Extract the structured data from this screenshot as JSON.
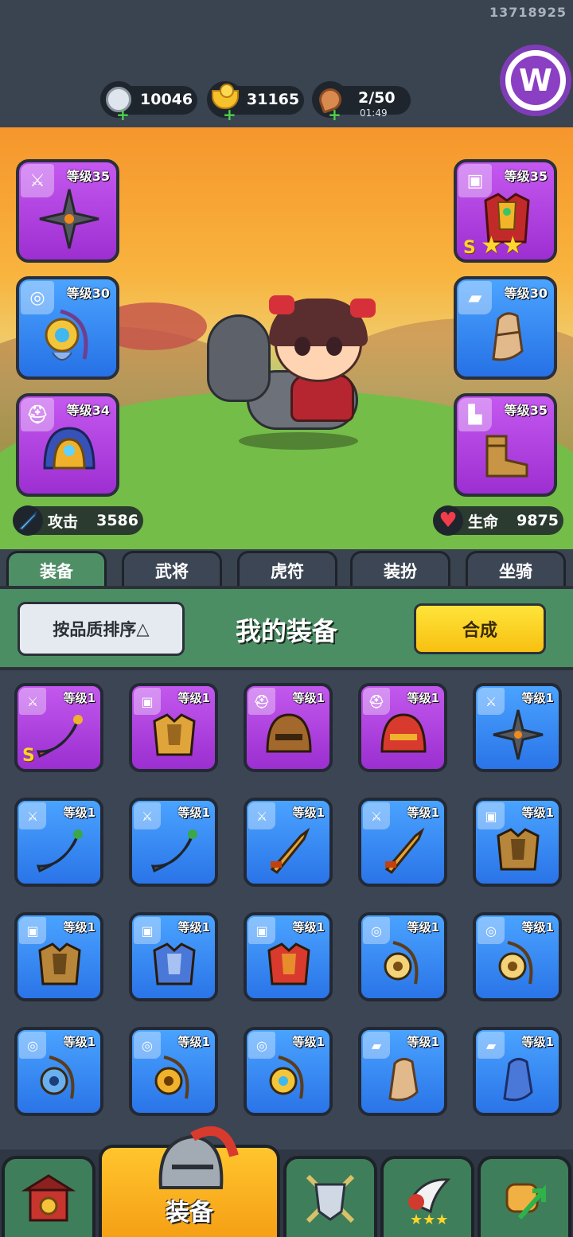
{
  "user_id": "13718925",
  "resources": {
    "silver": {
      "value": "10046",
      "icon": "silver-coin-icon"
    },
    "gold": {
      "value": "31165",
      "icon": "gold-ingot-icon"
    },
    "stamina": {
      "value": "2/50",
      "timer": "01:49",
      "icon": "meat-icon"
    }
  },
  "equipped": {
    "weapon": {
      "level": "等级35",
      "icon": "shuriken-icon",
      "type": "sword-badge",
      "rarity": "purple"
    },
    "amulet": {
      "level": "等级30",
      "icon": "amulet-icon",
      "type": "medal-badge",
      "rarity": "blue"
    },
    "helmet": {
      "level": "等级34",
      "icon": "helmet-icon",
      "type": "helmet-badge",
      "rarity": "purple"
    },
    "armor": {
      "level": "等级35",
      "icon": "armor-icon",
      "type": "armor-badge",
      "rarity": "purple",
      "rank": "S",
      "stars": 2
    },
    "gauntlet": {
      "level": "等级30",
      "icon": "gauntlet-icon",
      "type": "gauntlet-badge",
      "rarity": "blue"
    },
    "boots": {
      "level": "等级35",
      "icon": "boots-icon",
      "type": "boot-badge",
      "rarity": "purple"
    }
  },
  "stats": {
    "attack": {
      "label": "攻击",
      "value": "3586"
    },
    "hp": {
      "label": "生命",
      "value": "9875"
    }
  },
  "tabs": [
    "装备",
    "武将",
    "虎符",
    "装扮",
    "坐骑"
  ],
  "panel": {
    "sort_label": "按品质排序",
    "sort_arrow": "△",
    "title": "我的装备",
    "merge_label": "合成"
  },
  "inventory": [
    {
      "level": "等级1",
      "rarity": "purple",
      "badge": "sword",
      "icon": "scimitar-icon",
      "rank": "S"
    },
    {
      "level": "等级1",
      "rarity": "purple",
      "badge": "armor",
      "icon": "gold-armor-icon"
    },
    {
      "level": "等级1",
      "rarity": "purple",
      "badge": "helmet",
      "icon": "bronze-helmet-icon"
    },
    {
      "level": "等级1",
      "rarity": "purple",
      "badge": "helmet",
      "icon": "red-helmet-icon"
    },
    {
      "level": "等级1",
      "rarity": "blue",
      "badge": "sword",
      "icon": "shuriken-icon"
    },
    {
      "level": "等级1",
      "rarity": "blue",
      "badge": "sword",
      "icon": "curved-blade-icon"
    },
    {
      "level": "等级1",
      "rarity": "blue",
      "badge": "sword",
      "icon": "curved-blade-icon"
    },
    {
      "level": "等级1",
      "rarity": "blue",
      "badge": "sword",
      "icon": "golden-dagger-icon"
    },
    {
      "level": "等级1",
      "rarity": "blue",
      "badge": "sword",
      "icon": "golden-dagger-icon"
    },
    {
      "level": "等级1",
      "rarity": "blue",
      "badge": "armor",
      "icon": "bronze-armor-icon"
    },
    {
      "level": "等级1",
      "rarity": "blue",
      "badge": "armor",
      "icon": "bronze-armor-icon"
    },
    {
      "level": "等级1",
      "rarity": "blue",
      "badge": "armor",
      "icon": "blue-robe-icon"
    },
    {
      "level": "等级1",
      "rarity": "blue",
      "badge": "armor",
      "icon": "red-robe-icon"
    },
    {
      "level": "等级1",
      "rarity": "blue",
      "badge": "medal",
      "icon": "horn-necklace-icon"
    },
    {
      "level": "等级1",
      "rarity": "blue",
      "badge": "medal",
      "icon": "horn-necklace-icon"
    },
    {
      "level": "等级1",
      "rarity": "blue",
      "badge": "medal",
      "icon": "crystal-pendant-icon"
    },
    {
      "level": "等级1",
      "rarity": "blue",
      "badge": "medal",
      "icon": "gold-talisman-icon"
    },
    {
      "level": "等级1",
      "rarity": "blue",
      "badge": "medal",
      "icon": "amulet-icon"
    },
    {
      "level": "等级1",
      "rarity": "blue",
      "badge": "gauntlet",
      "icon": "leather-bracer-icon"
    },
    {
      "level": "等级1",
      "rarity": "blue",
      "badge": "gauntlet",
      "icon": "blue-bracer-icon"
    }
  ],
  "bottom_nav": {
    "home_icon": "gate-icon",
    "equip_label": "装备",
    "equip_icon": "knight-helmet-icon",
    "battle_icon": "shield-swords-icon",
    "hero_icon": "horn-stars-icon",
    "upgrade_icon": "fist-arrow-icon"
  }
}
